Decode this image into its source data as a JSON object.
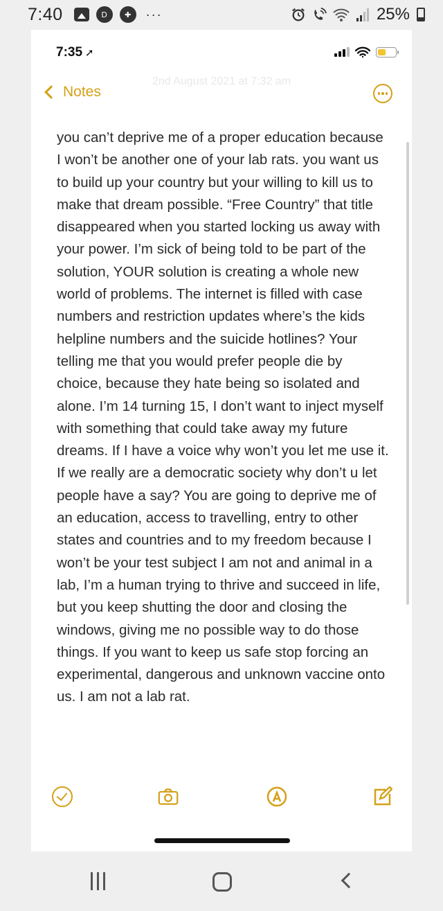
{
  "android_status": {
    "time": "7:40",
    "overflow": "···",
    "battery": "25%",
    "icons": [
      "gallery-icon",
      "disney-icon",
      "game-icon",
      "alarm-icon",
      "wifi-call-icon",
      "wifi-icon",
      "signal-icon",
      "battery-icon"
    ]
  },
  "ios_status": {
    "time": "7:35",
    "battery_level": 0.45,
    "battery_color": "#f4c430"
  },
  "nav": {
    "back_label": "Notes",
    "date": "2nd August 2021 at 7:32 am",
    "accent": "#d4a017"
  },
  "note": {
    "text": "you can’t deprive me of a proper education because I won’t be another one of your lab rats. you want us to build up your country but your willing to kill us to make that dream possible. “Free Country” that title disappeared when you started locking us away with your power. I’m sick of being told to be part of the solution, YOUR solution is creating a whole new world of problems. The internet is filled with case numbers and restriction updates where’s the kids helpline numbers and the suicide hotlines? Your telling me that you would prefer people die by choice, because they hate being so isolated and alone. I’m 14 turning 15, I don’t want to inject myself with something that could take away my future dreams. If I have a voice why won’t you let me use it. If we really are a democratic society why don’t u let people have a say? You are going to deprive me of an education, access to travelling, entry to other states and countries and to my freedom because I won’t be your test subject I am not and animal in a lab, I’m a human trying to thrive and succeed in life, but you keep shutting the door and closing the windows, giving me no possible way to do those things. If you want to keep us safe stop forcing an experimental, dangerous and unknown vaccine onto us. I am not a lab rat."
  },
  "toolbar": {
    "icons": [
      "checklist-icon",
      "camera-icon",
      "markup-icon",
      "compose-icon"
    ]
  },
  "android_nav": {
    "icons": [
      "recent-apps-icon",
      "home-icon",
      "back-icon"
    ]
  }
}
